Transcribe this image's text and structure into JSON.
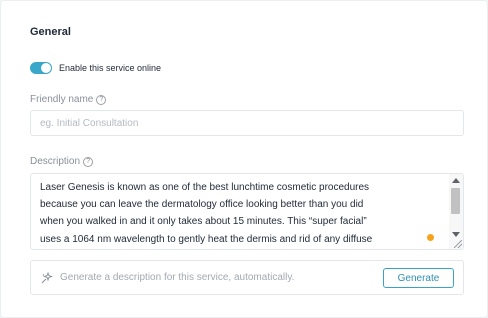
{
  "section": {
    "title": "General"
  },
  "online_toggle": {
    "label": "Enable this service online",
    "enabled": true
  },
  "friendly_name": {
    "label": "Friendly name",
    "help_icon": "?",
    "value": "",
    "placeholder": "eg. Initial Consultation"
  },
  "description": {
    "label": "Description",
    "help_icon": "?",
    "lines": [
      "Laser Genesis is known as one of the best lunchtime cosmetic procedures",
      "because you can leave the dermatology office looking better than you did",
      "when you walked in and it only takes about 15 minutes. This “super facial”",
      "uses a 1064 nm wavelength to gently heat the dermis and rid of any diffuse"
    ]
  },
  "generator": {
    "prompt": "Generate a description for this service, automatically.",
    "button_label": "Generate",
    "icon": "sparkle-icon"
  },
  "colors": {
    "accent": "#38a7c9",
    "button_text": "#2f8fb1",
    "indicator_dot": "#f4a41c"
  }
}
